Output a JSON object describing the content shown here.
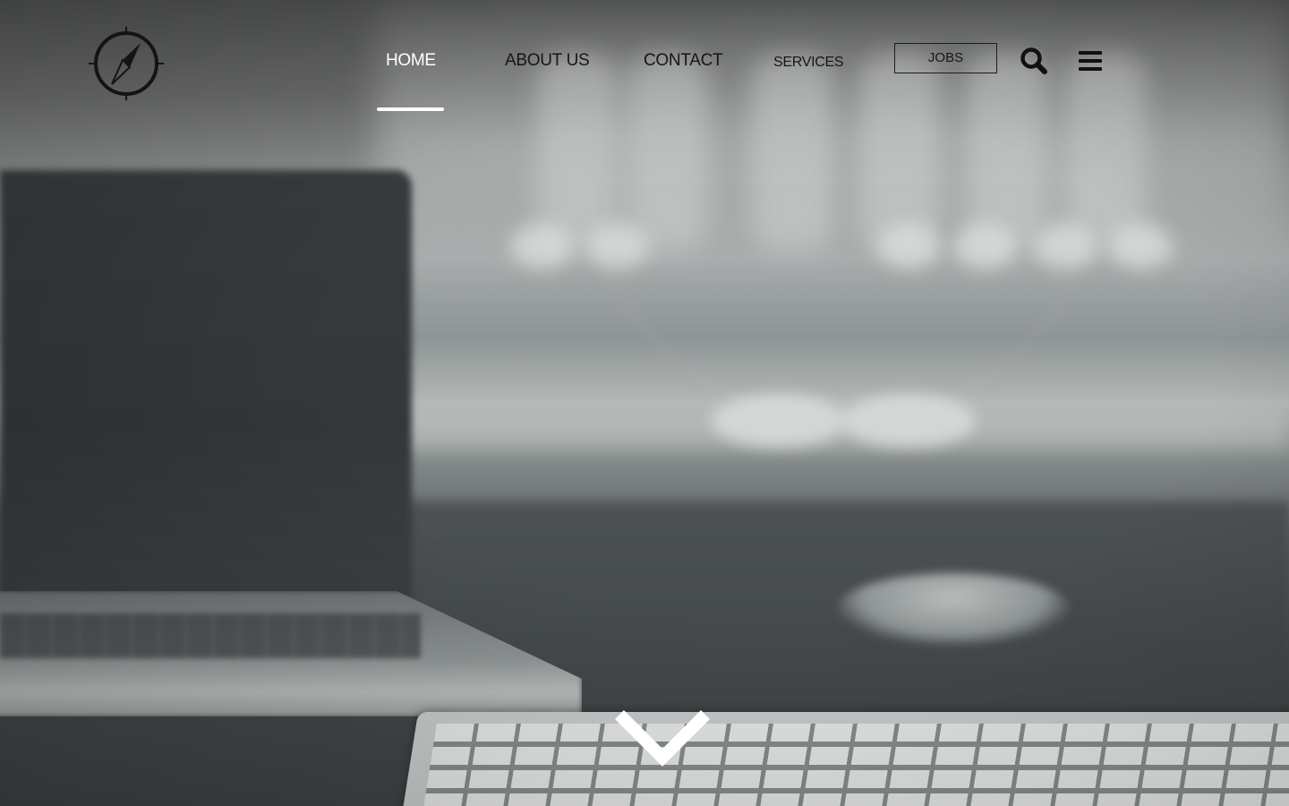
{
  "header": {
    "nav": {
      "home": "HOME",
      "about": "ABOUT US",
      "contact": "CONTACT",
      "services": "SERVICES"
    },
    "active_item": "home",
    "jobs_label": "JOBS"
  },
  "icons": {
    "logo": "compass-logo-icon",
    "search": "search-icon",
    "menu": "hamburger-menu-icon",
    "scroll": "chevron-down-icon"
  },
  "colors": {
    "nav_text": "#161616",
    "active_text": "#ffffff",
    "underline": "#ffffff"
  }
}
